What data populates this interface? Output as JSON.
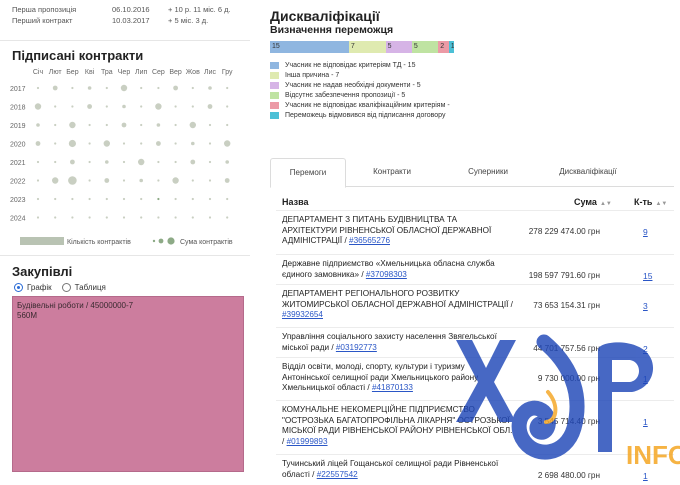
{
  "firsts": [
    {
      "label": "Перша пропозиція",
      "date": "06.10.2016",
      "ago": "+ 10 р. 11 міс. 6 д."
    },
    {
      "label": "Перший контракт",
      "date": "10.03.2017",
      "ago": "+ 5 міс. 3 д."
    }
  ],
  "signed": {
    "title": "Підписані контракти",
    "months": [
      "Січ",
      "Лют",
      "Бер",
      "Кві",
      "Тра",
      "Чер",
      "Лип",
      "Сер",
      "Вер",
      "Жов",
      "Лис",
      "Гру"
    ],
    "years": [
      "2017",
      "2018",
      "2019",
      "2020",
      "2021",
      "2022",
      "2023",
      "2024"
    ],
    "legend_count": "Кількість контрактів",
    "legend_sum": "Сума контрактів",
    "dot_color": "#c9cfc2",
    "dot_dark": "#8daa86"
  },
  "purchases": {
    "title": "Закупівлі",
    "radio_chart": "Графік",
    "radio_table": "Таблиця",
    "treemap_label": "Будівельні роботи / 45000000-7",
    "treemap_value": "560M",
    "treemap_color": "#cc7d9e"
  },
  "disq": {
    "title": "Дискваліфікації",
    "subtitle": "Визначення переможця",
    "segments": [
      {
        "label": "15",
        "value": 15,
        "color": "#8fb6e0"
      },
      {
        "label": "7",
        "value": 7,
        "color": "#dfeab0"
      },
      {
        "label": "5",
        "value": 5,
        "color": "#d6b4e6"
      },
      {
        "label": "5",
        "value": 5,
        "color": "#bfe3a2"
      },
      {
        "label": "2",
        "value": 2,
        "color": "#ec9aa6"
      },
      {
        "label": "1",
        "value": 1,
        "color": "#4cc0d6"
      }
    ],
    "legend": [
      "Учасник не відповідає критеріям ТД - 15",
      "Інша причина - 7",
      "Учасник не надав необхідні документи - 5",
      "Відсутнє забезпечення пропозиції - 5",
      "Учасник не відповідає кваліфікаційним критеріям - ",
      "Переможець відмовився від підписання договору"
    ]
  },
  "tabs": [
    "Перемоги",
    "Контракти",
    "Суперники",
    "Дискваліфікації"
  ],
  "table": {
    "col_name": "Назва",
    "col_sum": "Сума",
    "col_count": "К-ть",
    "rows": [
      {
        "name": "ДЕПАРТАМЕНТ З ПИТАНЬ БУДІВНИЦТВА ТА АРХІТЕКТУРИ РІВНЕНСЬКОЇ ОБЛАСНОЇ ДЕРЖАВНОЇ АДМІНІСТРАЦІЇ / ",
        "code": "#36565276",
        "sum": "278 229 474.00 грн",
        "count": "9"
      },
      {
        "name": "Державне підприємство «Хмельницька обласна служба єдиного замовника» / ",
        "code": "#37098303",
        "sum": "198 597 791.60 грн",
        "count": "15"
      },
      {
        "name": "ДЕПАРТАМЕНТ РЕГІОНАЛЬНОГО РОЗВИТКУ ЖИТОМИРСЬКОЇ ОБЛАСНОЇ ДЕРЖАВНОЇ АДМІНІСТРАЦІЇ / ",
        "code": "#39932654",
        "sum": "73 653 154.31 грн",
        "count": "3"
      },
      {
        "name": "Управління соціального захисту населення Звягельської міської ради / ",
        "code": "#03192773",
        "sum": "44 701 757.56 грн",
        "count": "2"
      },
      {
        "name": "Відділ освіти, молоді, спорту, культури і туризму Антонінської селищної ради Хмельницького району Хмельницької області / ",
        "code": "#41870133",
        "sum": "9 730 000.00 грн",
        "count": "1"
      },
      {
        "name": "КОМУНАЛЬНЕ НЕКОМЕРЦІЙНЕ ПІДПРИЄМСТВО \"ОСТРОЗЬКА БАГАТОПРОФІЛЬНА ЛІКАРНЯ\" ОСТРОЗЬКОЇ МІСЬКОЇ РАДИ РІВНЕНСЬКОЇ РАЙОНУ РІВНЕНСЬКОЇ ОБЛ. / ",
        "code": "#01999893",
        "sum": "3 545 714.40 грн",
        "count": "1"
      },
      {
        "name": "Тучинський ліцей Гощанської селищної ради Рівненської області / ",
        "code": "#22557542",
        "sum": "2 698 480.00 грн",
        "count": "1"
      }
    ]
  },
  "watermark": {
    "text": "INFO",
    "color": "#1f47b8",
    "accent": "#f5a623"
  }
}
